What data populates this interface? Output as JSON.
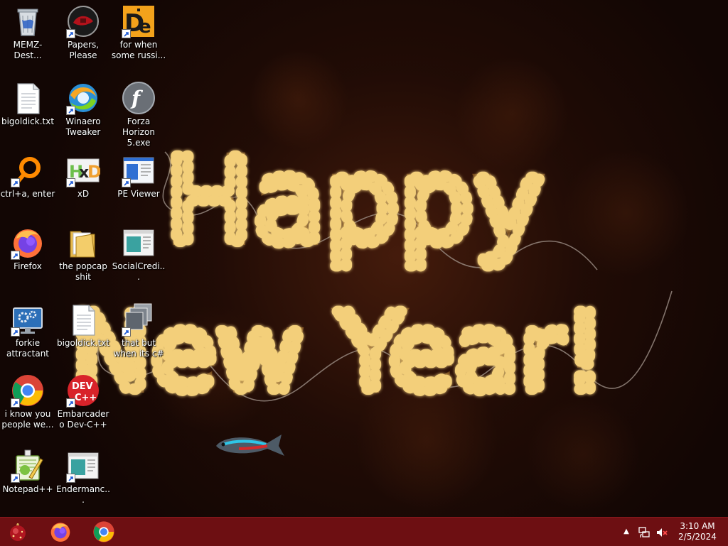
{
  "desktop": {
    "wallpaper_text_line1": "Happy",
    "wallpaper_text_line2": "New Year!",
    "icons": [
      {
        "label": "MEMZ-Dest...",
        "icon": "recycle-bin-icon"
      },
      {
        "label": "Papers, Please",
        "icon": "papers-please-icon"
      },
      {
        "label": "for when some russi...",
        "icon": "de-app-icon"
      },
      {
        "label": "bigoldick.txt",
        "icon": "text-file-icon"
      },
      {
        "label": "Winaero Tweaker",
        "icon": "winaero-tweaker-icon"
      },
      {
        "label": "Forza Horizon 5.exe",
        "icon": "flash-icon"
      },
      {
        "label": "ctrl+a, enter",
        "icon": "orange-ring-icon"
      },
      {
        "label": "xD",
        "icon": "hxd-icon"
      },
      {
        "label": "PE Viewer",
        "icon": "pe-viewer-icon"
      },
      {
        "label": "Firefox",
        "icon": "firefox-icon"
      },
      {
        "label": "the popcap shit",
        "icon": "folder-icon"
      },
      {
        "label": "SocialCredi...",
        "icon": "app-window-icon"
      },
      {
        "label": "forkie attractant",
        "icon": "monitor-gears-icon"
      },
      {
        "label": "bigoldick.txt",
        "icon": "text-file-icon"
      },
      {
        "label": "that but when its c#",
        "icon": "stacked-windows-icon"
      },
      {
        "label": "i know you people we...",
        "icon": "chrome-icon"
      },
      {
        "label": "Embarcadero Dev-C++",
        "icon": "dev-cpp-icon"
      },
      {
        "label": "Notepad++",
        "icon": "notepad-plus-plus-icon"
      },
      {
        "label": "Endermanc...",
        "icon": "app-window-icon"
      }
    ]
  },
  "taskbar": {
    "start_icon": "start-orb-icon",
    "pinned": [
      {
        "name": "Firefox",
        "icon": "firefox-icon"
      },
      {
        "name": "Google Chrome",
        "icon": "chrome-icon"
      }
    ],
    "tray": {
      "chevron_glyph": "▲",
      "network_icon": "network-icon",
      "volume_icon": "volume-muted-icon"
    },
    "clock": {
      "time": "3:10 AM",
      "date": "2/5/2024"
    }
  },
  "colors": {
    "taskbar": "#6d0f12",
    "neon_gold": "#f3cf7a",
    "wallpaper_dark": "#120604"
  }
}
